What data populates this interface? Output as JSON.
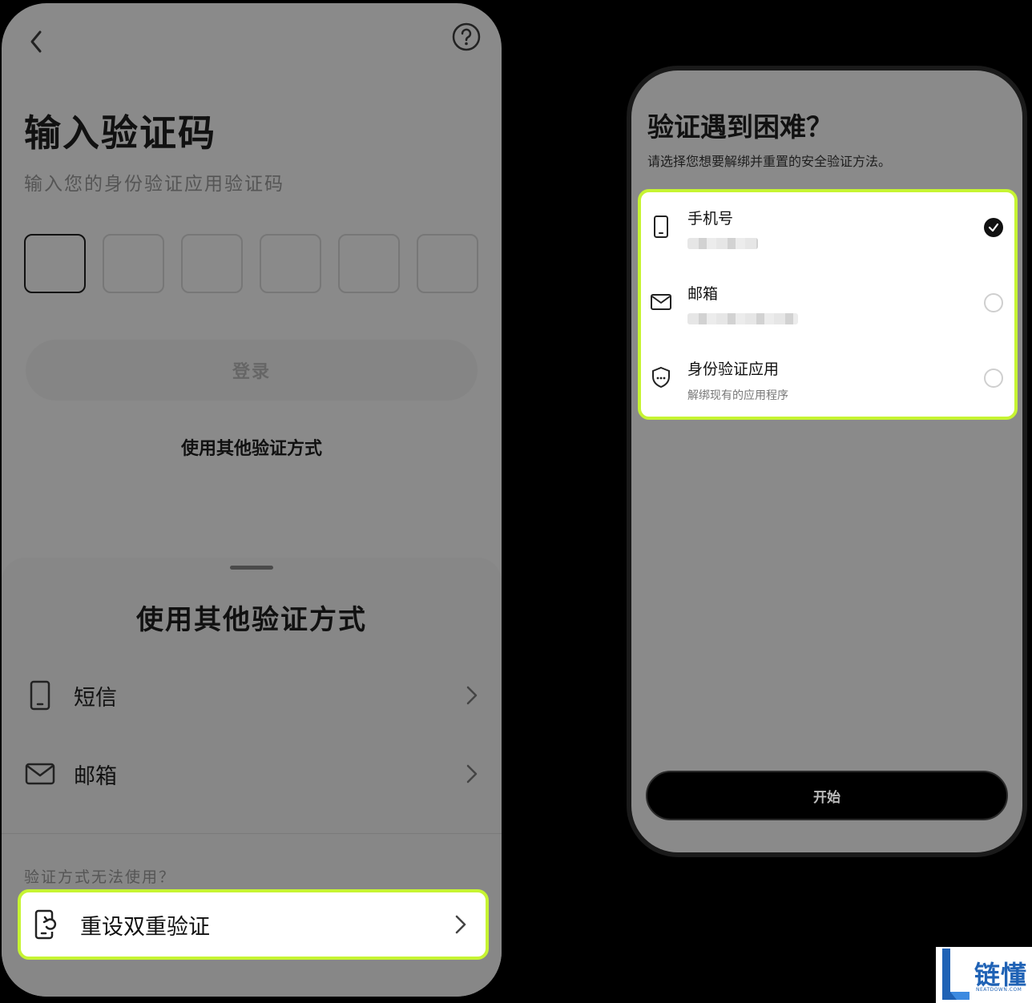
{
  "left_screen": {
    "title": "输入验证码",
    "subtitle": "输入您的身份验证应用验证码",
    "code_boxes": 6,
    "login_label": "登录",
    "other_methods_link": "使用其他验证方式"
  },
  "sheet": {
    "title": "使用其他验证方式",
    "items": [
      {
        "icon": "phone-icon",
        "label": "短信"
      },
      {
        "icon": "mail-icon",
        "label": "邮箱"
      }
    ],
    "hint": "验证方式无法使用？",
    "reset_label": "重设双重验证"
  },
  "right_screen": {
    "title": "验证遇到困难？",
    "subtitle": "请选择您想要解绑并重置的安全验证方法。",
    "options": [
      {
        "icon": "phone-icon",
        "name": "手机号",
        "selected": true
      },
      {
        "icon": "mail-icon",
        "name": "邮箱",
        "selected": false
      },
      {
        "icon": "shield-icon",
        "name": "身份验证应用",
        "sub": "解绑现有的应用程序",
        "selected": false
      }
    ],
    "start_label": "开始"
  },
  "watermark": {
    "name": "链懂",
    "sub": "NEATDOWN.COM"
  },
  "colors": {
    "highlight": "#c6f432",
    "overlay": "#8a8a8a",
    "text": "#111111"
  }
}
